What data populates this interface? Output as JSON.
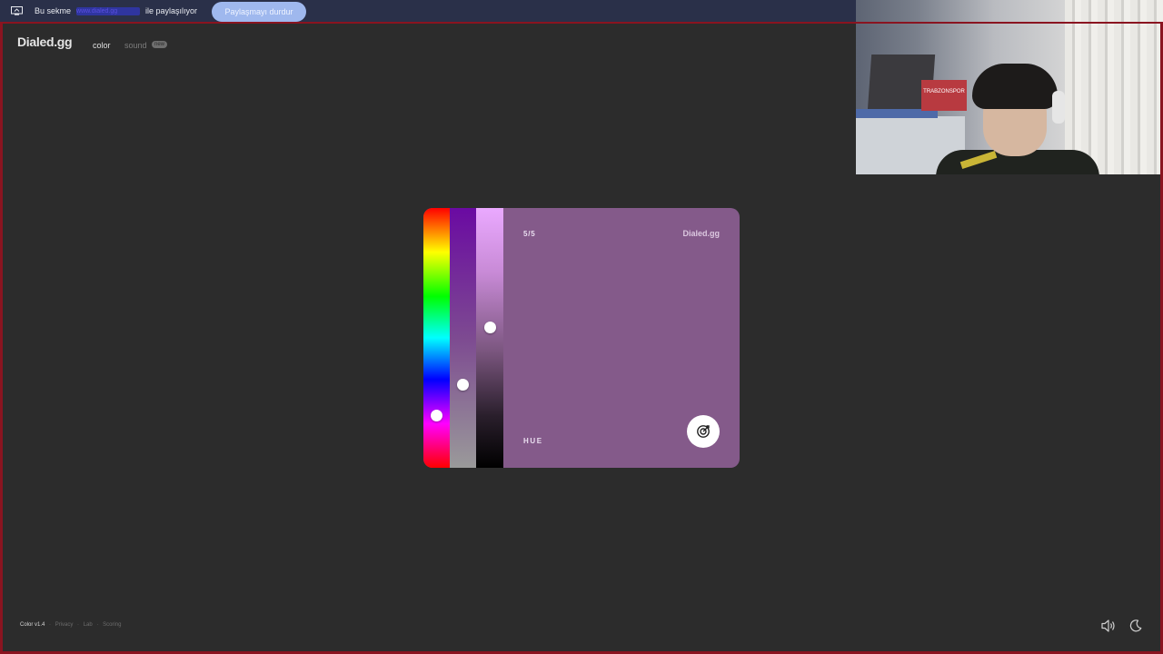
{
  "share_bar": {
    "prefix": "Bu sekme",
    "redacted_site": "www.dialed.gg",
    "suffix": "ile paylaşılıyor",
    "stop_button": "Paylaşmayı durdur"
  },
  "header": {
    "logo": "Dialed.gg",
    "nav": {
      "color": "color",
      "sound": "sound",
      "sound_badge": "new"
    }
  },
  "card": {
    "background_color": "#845a8a",
    "counter": "5/5",
    "brand": "Dialed.gg",
    "mode_label": "HUE",
    "hue_knob_level": 0.8,
    "saturation_knob_level": 0.68,
    "lightness_knob_level": 0.46
  },
  "footer": {
    "version": "Color v1.4",
    "links": [
      "Privacy",
      "Lab",
      "Scoring"
    ]
  },
  "icons": {
    "share_icon": "monitor-icon",
    "submit_icon": "target-icon",
    "sound_icon": "speaker-icon",
    "theme_icon": "moon-icon"
  }
}
